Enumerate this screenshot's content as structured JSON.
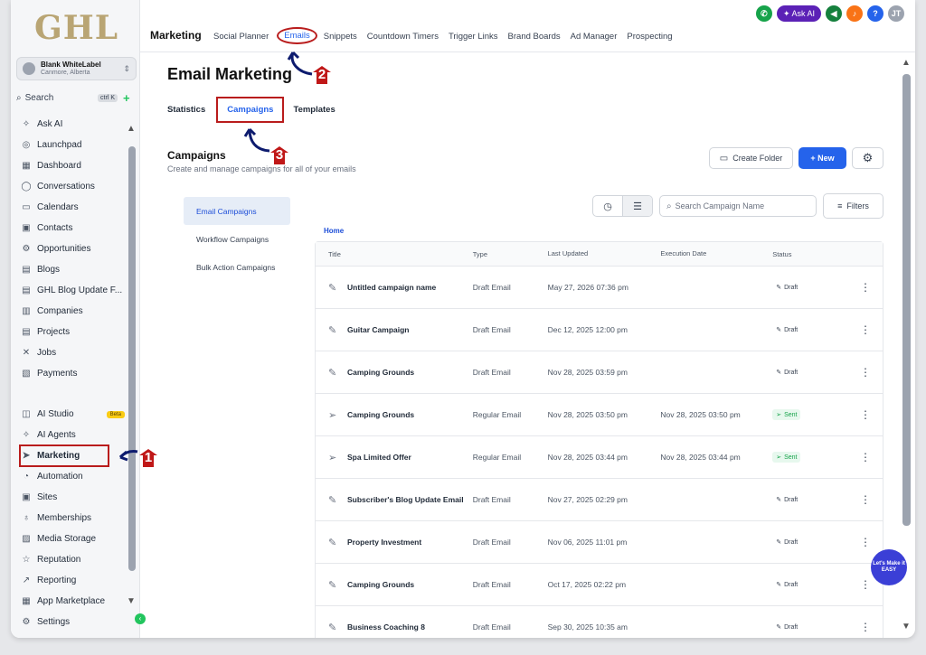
{
  "sidebar": {
    "logo": "GHL",
    "account": {
      "name": "Blank WhiteLabel",
      "location": "Canmore, Alberta"
    },
    "search": {
      "label": "Search",
      "shortcut": "ctrl K"
    },
    "items_top": [
      {
        "label": "Ask AI",
        "icon": "✧"
      },
      {
        "label": "Launchpad",
        "icon": "◎"
      },
      {
        "label": "Dashboard",
        "icon": "▦"
      },
      {
        "label": "Conversations",
        "icon": "◯"
      },
      {
        "label": "Calendars",
        "icon": "▭"
      },
      {
        "label": "Contacts",
        "icon": "▣"
      },
      {
        "label": "Opportunities",
        "icon": "⚙"
      },
      {
        "label": "Blogs",
        "icon": "▤"
      },
      {
        "label": "GHL Blog Update F...",
        "icon": "▤"
      },
      {
        "label": "Companies",
        "icon": "▥"
      },
      {
        "label": "Projects",
        "icon": "▤"
      },
      {
        "label": "Jobs",
        "icon": "✕"
      },
      {
        "label": "Payments",
        "icon": "▧"
      }
    ],
    "items_bottom": [
      {
        "label": "AI Studio",
        "icon": "◫",
        "badge": "Beta"
      },
      {
        "label": "AI Agents",
        "icon": "✧"
      },
      {
        "label": "Marketing",
        "icon": "➤"
      },
      {
        "label": "Automation",
        "icon": "◔"
      },
      {
        "label": "Sites",
        "icon": "▣"
      },
      {
        "label": "Memberships",
        "icon": "♁"
      },
      {
        "label": "Media Storage",
        "icon": "▨"
      },
      {
        "label": "Reputation",
        "icon": "☆"
      },
      {
        "label": "Reporting",
        "icon": "↗"
      },
      {
        "label": "App Marketplace",
        "icon": "▦"
      },
      {
        "label": "Settings",
        "icon": "⚙"
      }
    ]
  },
  "topbar": {
    "title": "Marketing",
    "tabs": [
      "Social Planner",
      "Emails",
      "Snippets",
      "Countdown Timers",
      "Trigger Links",
      "Brand Boards",
      "Ad Manager",
      "Prospecting"
    ],
    "active_tab": "Emails",
    "ask_ai": "✦ Ask AI",
    "user_initials": "JT",
    "help": "?"
  },
  "main": {
    "page_title": "Email Marketing",
    "subtabs": [
      "Statistics",
      "Campaigns",
      "Templates"
    ],
    "section_title": "Campaigns",
    "section_desc": "Create and manage campaigns for all of your emails",
    "create_folder": "Create Folder",
    "new_button": "+ New",
    "left_menu": [
      "Email Campaigns",
      "Workflow Campaigns",
      "Bulk Action Campaigns"
    ],
    "search_placeholder": "Search Campaign Name",
    "filters": "Filters",
    "breadcrumb": "Home",
    "columns": [
      "Title",
      "Type",
      "Last Updated",
      "Execution Date",
      "Status"
    ],
    "rows": [
      {
        "title": "Untitled campaign name",
        "icon": "✎",
        "type": "Draft Email",
        "updated": "May 27, 2026 07:36 pm",
        "exec": "",
        "status": "Draft"
      },
      {
        "title": "Guitar Campaign",
        "icon": "✎",
        "type": "Draft Email",
        "updated": "Dec 12, 2025 12:00 pm",
        "exec": "",
        "status": "Draft"
      },
      {
        "title": "Camping Grounds",
        "icon": "✎",
        "type": "Draft Email",
        "updated": "Nov 28, 2025 03:59 pm",
        "exec": "",
        "status": "Draft"
      },
      {
        "title": "Camping Grounds",
        "icon": "➢",
        "type": "Regular Email",
        "updated": "Nov 28, 2025 03:50 pm",
        "exec": "Nov 28, 2025 03:50 pm",
        "status": "Sent"
      },
      {
        "title": "Spa Limited Offer",
        "icon": "➢",
        "type": "Regular Email",
        "updated": "Nov 28, 2025 03:44 pm",
        "exec": "Nov 28, 2025 03:44 pm",
        "status": "Sent"
      },
      {
        "title": "Subscriber's Blog Update Email",
        "icon": "✎",
        "type": "Draft Email",
        "updated": "Nov 27, 2025 02:29 pm",
        "exec": "",
        "status": "Draft"
      },
      {
        "title": "Property Investment",
        "icon": "✎",
        "type": "Draft Email",
        "updated": "Nov 06, 2025 11:01 pm",
        "exec": "",
        "status": "Draft"
      },
      {
        "title": "Camping Grounds",
        "icon": "✎",
        "type": "Draft Email",
        "updated": "Oct 17, 2025 02:22 pm",
        "exec": "",
        "status": "Draft"
      },
      {
        "title": "Business Coaching 8",
        "icon": "✎",
        "type": "Draft Email",
        "updated": "Sep 30, 2025 10:35 am",
        "exec": "",
        "status": "Draft"
      }
    ]
  },
  "fab_text": "Let's Make it EASY",
  "annotations": [
    "1",
    "2",
    "3"
  ],
  "colors": {
    "accent": "#2563eb",
    "annotation": "#b91c1c",
    "sent": "#16a34a"
  }
}
